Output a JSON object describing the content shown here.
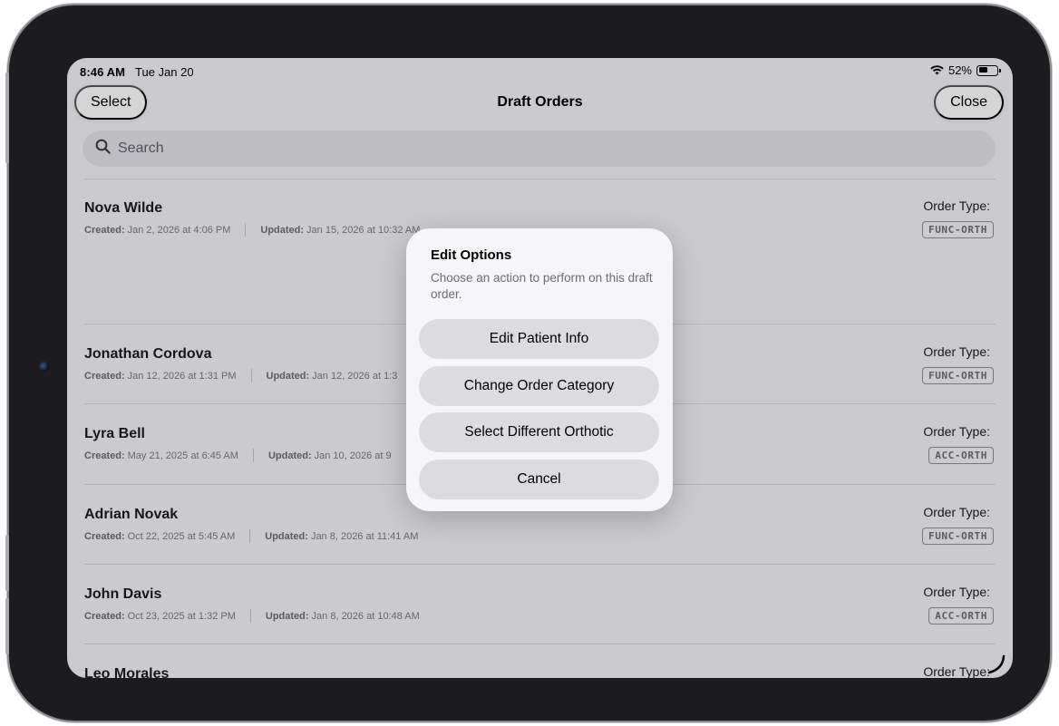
{
  "status_bar": {
    "time": "8:46 AM",
    "date": "Tue Jan 20",
    "battery_percent": "52%",
    "battery_level": 0.52
  },
  "nav": {
    "left_button": "Select",
    "title": "Draft Orders",
    "right_button": "Close"
  },
  "search": {
    "placeholder": "Search",
    "value": ""
  },
  "list_labels": {
    "created": "Created:",
    "updated": "Updated:",
    "order_type": "Order Type:"
  },
  "orders": [
    {
      "name": "Nova Wilde",
      "created": "Jan 2, 2026 at 4:06 PM",
      "updated": "Jan 15, 2026 at 10:32 AM",
      "order_type": "FUNC-ORTH"
    },
    {
      "name": "Jonathan Cordova",
      "created": "Jan 12, 2026 at 1:31 PM",
      "updated": "Jan 12, 2026 at 1:3",
      "order_type": "FUNC-ORTH"
    },
    {
      "name": "Lyra Bell",
      "created": "May 21, 2025 at 6:45 AM",
      "updated": "Jan 10, 2026 at 9",
      "order_type": "ACC-ORTH"
    },
    {
      "name": "Adrian Novak",
      "created": "Oct 22, 2025 at 5:45 AM",
      "updated": "Jan 8, 2026 at 11:41 AM",
      "order_type": "FUNC-ORTH"
    },
    {
      "name": "John Davis",
      "created": "Oct 23, 2025 at 1:32 PM",
      "updated": "Jan 8, 2026 at 10:48 AM",
      "order_type": "ACC-ORTH"
    },
    {
      "name": "Leo Morales",
      "order_type_label_only": true
    }
  ],
  "modal": {
    "title": "Edit Options",
    "description": "Choose an action to perform on this draft order.",
    "buttons": [
      "Edit Patient Info",
      "Change Order Category",
      "Select Different Orthotic",
      "Cancel"
    ]
  }
}
